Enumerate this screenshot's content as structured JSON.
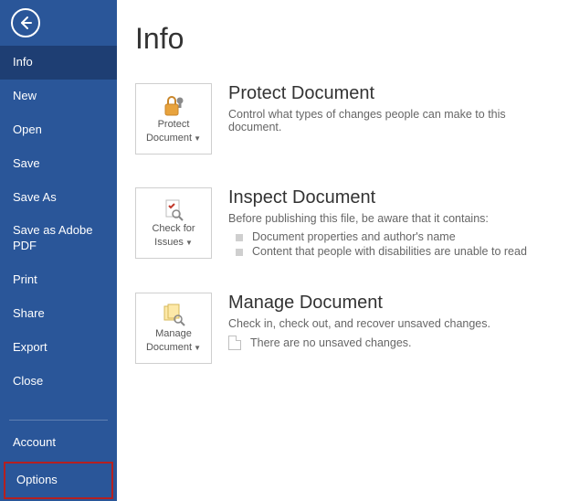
{
  "sidebar": {
    "items": [
      {
        "label": "Info"
      },
      {
        "label": "New"
      },
      {
        "label": "Open"
      },
      {
        "label": "Save"
      },
      {
        "label": "Save As"
      },
      {
        "label": "Save as Adobe PDF"
      },
      {
        "label": "Print"
      },
      {
        "label": "Share"
      },
      {
        "label": "Export"
      },
      {
        "label": "Close"
      }
    ],
    "bottom": [
      {
        "label": "Account"
      },
      {
        "label": "Options"
      }
    ]
  },
  "page": {
    "title": "Info"
  },
  "protect": {
    "title": "Protect Document",
    "desc": "Control what types of changes people can make to this document.",
    "tile_line1": "Protect",
    "tile_line2": "Document"
  },
  "inspect": {
    "title": "Inspect Document",
    "desc": "Before publishing this file, be aware that it contains:",
    "tile_line1": "Check for",
    "tile_line2": "Issues",
    "bullets": [
      "Document properties and author's name",
      "Content that people with disabilities are unable to read"
    ]
  },
  "manage": {
    "title": "Manage Document",
    "desc": "Check in, check out, and recover unsaved changes.",
    "tile_line1": "Manage",
    "tile_line2": "Document",
    "none": "There are no unsaved changes."
  }
}
